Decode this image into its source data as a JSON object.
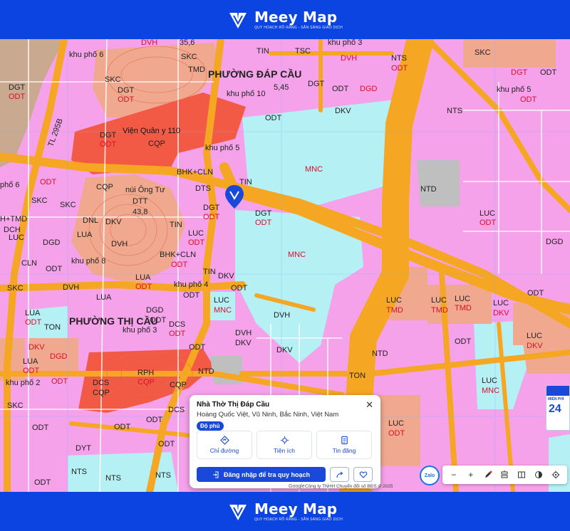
{
  "brand": {
    "name": "Meey Map",
    "tagline": "QUY HOẠCH RÕ RÀNG - SẴN SÀNG GIAO DỊCH"
  },
  "map": {
    "labels": {
      "khu_pho_6_top": "khu phố 6",
      "dvh_1": "DVH",
      "skc_1": "SKC",
      "tmd_1": "TMD",
      "elev_1": "35,6",
      "tin_1": "TIN",
      "tsc_1": "TSC",
      "khu_pho_3": "khu phố 3",
      "dvh_2": "DVH",
      "nts_1": "NTS",
      "odt_1": "ODT",
      "skc_2": "SKC",
      "dgt_1": "DGT",
      "odt_2": "ODT",
      "phuong_dap_cau": "PHƯỜNG ĐÁP CẦU",
      "elev_2": "5,45",
      "dgt_2": "DGT",
      "khu_pho_10": "khu phố 10",
      "odt_3": "ODT",
      "dgd_1": "DGD",
      "dgt_3": "DGT",
      "odt_4": "ODT",
      "khu_pho_5_right": "khu phố 5",
      "odt_5": "ODT",
      "nts_2": "NTS",
      "skc_3": "SKC",
      "dgt_4": "DGT",
      "odt_6": "ODT",
      "dkv_1": "DKV",
      "odt_7": "ODT",
      "vien_quan_y": "Viện Quân y 110",
      "dgt_5": "DGT",
      "odt_8": "ODT",
      "cqp_1": "CQP",
      "khu_pho_5": "khu phố 5",
      "tl295b": "TL 295B",
      "mnc_1": "MNC",
      "bhk_cln_1": "BHK+CLN",
      "tin_2": "TIN",
      "dts_1": "DTS",
      "pho_6": "phố 6",
      "odt_9": "ODT",
      "cqp_2": "CQP",
      "nui_ong_tu": "núi Ông Tư",
      "skc_4": "SKC",
      "dtt_1": "DTT",
      "elev_3": "43,8",
      "ntd_1": "NTD",
      "dgt_6": "DGT",
      "odt_10": "ODT",
      "dgt_7": "DGT",
      "odt_11": "ODT",
      "h_tmd": "H+TMD",
      "dch_1": "DCH",
      "dnl_1": "DNL",
      "dkv_2": "DKV",
      "luc_1": "LUC",
      "odt_12": "ODT",
      "dgd_2": "DGD",
      "lua_1": "LUA",
      "tin_3": "TIN",
      "luc_2": "LUC",
      "odt_13": "ODT",
      "dvh_3": "DVH",
      "mnc_2": "MNC",
      "luc_3": "LUC",
      "dgd_3": "DGD",
      "khu_pho_8": "khu phố 8",
      "bhk_cln_2": "BHK+CLN",
      "odt_14": "ODT",
      "cln_1": "CLN",
      "odt_15": "ODT",
      "lua_2": "LUA",
      "odt_16": "ODT",
      "tin_4": "TIN",
      "dkv_3": "DKV",
      "skc_5": "SKC",
      "dvh_4": "DVH",
      "lua_3": "LUA",
      "khu_pho_4": "khu phố 4",
      "odt_17": "ODT",
      "luc_4": "LUC",
      "tmd_2": "TMD",
      "luc_5": "LUC",
      "tmd_3": "TMD",
      "dkv_4": "DKV",
      "luc_6": "LUC",
      "odt_18": "ODT",
      "luc_7": "LUC",
      "dkv_5": "DKV",
      "phuong_thi_cau": "PHƯỜNG THỊ CẦU",
      "dgd_4": "DGD",
      "dvh_5": "DVH",
      "dcs_1": "DCS",
      "odt_19": "ODT",
      "odt_20": "ODT",
      "khu_pho_3_b": "khu phố 3",
      "ton_1": "TON",
      "dkv_6": "DKV",
      "dvh_6": "DVH",
      "odt_21": "ODT",
      "dgd_5": "DGD",
      "dkv_7": "DKV",
      "lua_4": "LUA",
      "odt_22": "ODT",
      "rph_1": "RPH",
      "cqp_3": "CQP",
      "cqp_4": "CQP",
      "ntd_2": "NTD",
      "ntd_3": "NTD",
      "ton_2": "TON",
      "luc_8": "LUC",
      "mnc_3": "MNC",
      "khu_pho_2": "khu phố 2",
      "odt_23": "ODT",
      "dcs_2": "DCS",
      "cqp_5": "CQP",
      "skc_6": "SKC",
      "odt_24": "ODT",
      "odt_25": "ODT",
      "dcs_3": "DCS",
      "odt_26": "ODT",
      "dyt_1": "DYT",
      "odt_27": "ODT",
      "luc_9": "LUC",
      "odt_28": "ODT",
      "nts_3": "NTS",
      "nts_4": "NTS",
      "nts_5": "NTS",
      "odt_29": "ODT",
      "odt_30": "ODT",
      "luc_10": "LUC",
      "odt_31": "ODT",
      "lua_5": "LUA"
    }
  },
  "info_card": {
    "title": "Nhà Thờ Thị Đáp Cầu",
    "address": "Hoàng Quốc Việt, Vũ Ninh, Bắc Ninh, Việt Nam",
    "badge": "Độ phủ",
    "close": "✕",
    "actions": [
      {
        "label": "Chỉ đường"
      },
      {
        "label": "Tiện ích"
      },
      {
        "label": "Tin đăng"
      }
    ],
    "login_button": "Đăng nhập để tra quy hoạch"
  },
  "toolbar": {
    "zalo": "Zalo",
    "zoom_out": "−",
    "zoom_in": "+"
  },
  "attribution": {
    "google": "Google",
    "copyright": "Công ty TNHH Chuyển đổi số BĐS © 2025"
  },
  "ad": {
    "text": "MIỄN PHÍ",
    "number": "24"
  }
}
